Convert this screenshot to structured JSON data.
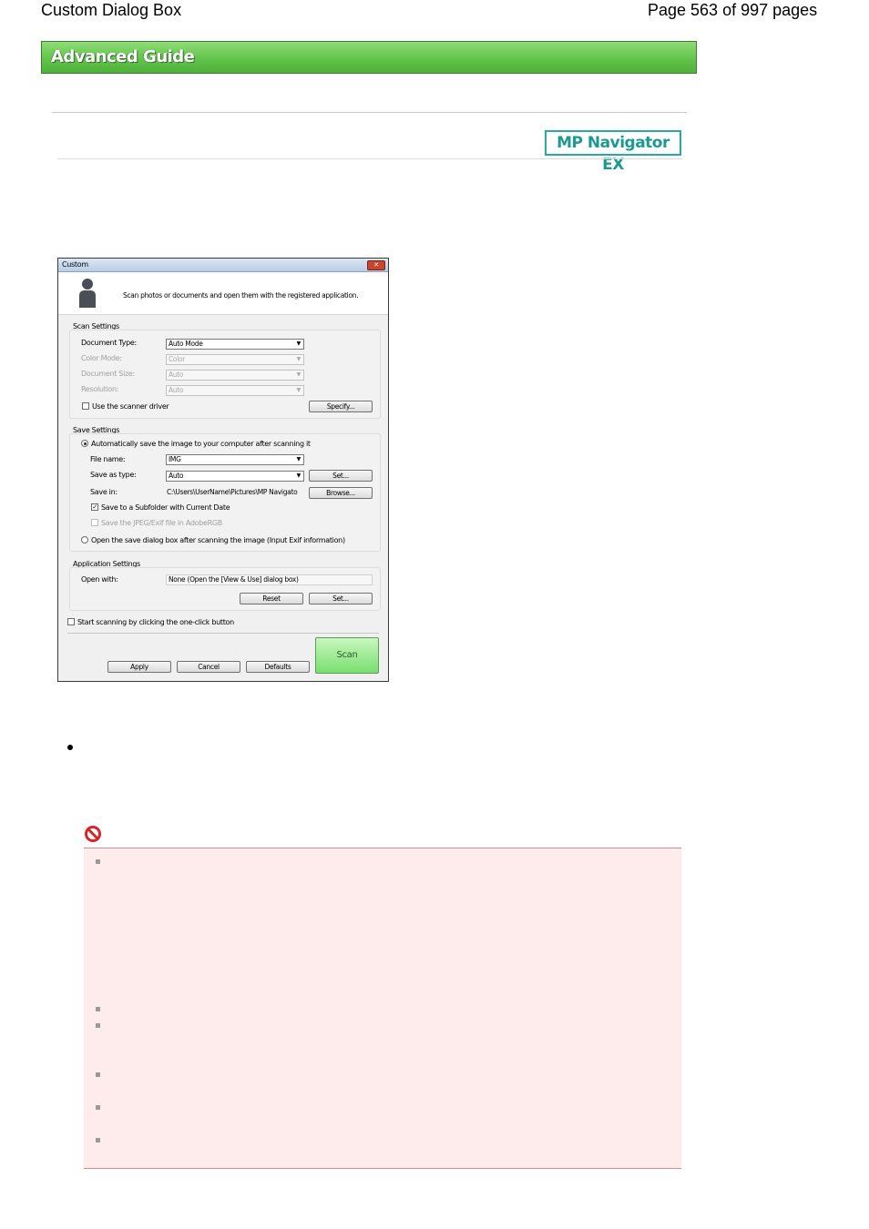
{
  "page_header": {
    "title": "Custom Dialog Box",
    "page_info": "Page 563 of 997 pages"
  },
  "guide_banner": "Advanced Guide",
  "logo": "MP Navigator EX",
  "dialog": {
    "title": "Custom",
    "close_glyph": "✕",
    "description": "Scan photos or documents and open them with the registered application.",
    "scan_settings": {
      "heading": "Scan Settings",
      "document_type_label": "Document Type:",
      "document_type_value": "Auto Mode",
      "color_mode_label": "Color Mode:",
      "color_mode_value": "Color",
      "document_size_label": "Document Size:",
      "document_size_value": "Auto",
      "resolution_label": "Resolution:",
      "resolution_value": "Auto",
      "use_driver_label": "Use the scanner driver",
      "specify_button": "Specify..."
    },
    "save_settings": {
      "heading": "Save Settings",
      "auto_save_label": "Automatically save the image to your computer after scanning it",
      "file_name_label": "File name:",
      "file_name_value": "IMG",
      "save_as_type_label": "Save as type:",
      "save_as_type_value": "Auto",
      "set_button": "Set...",
      "save_in_label": "Save in:",
      "save_in_value": "C:\\Users\\UserName\\Pictures\\MP Navigato",
      "browse_button": "Browse...",
      "subfolder_label": "Save to a Subfolder with Current Date",
      "adobergb_label": "Save the JPEG/Exif file in AdobeRGB",
      "open_save_dialog_label": "Open the save dialog box after scanning the image (Input Exif information)"
    },
    "application_settings": {
      "heading": "Application Settings",
      "open_with_label": "Open with:",
      "open_with_value": "None (Open the [View & Use] dialog box)",
      "reset_button": "Reset",
      "set_button": "Set..."
    },
    "one_click_label": "Start scanning by clicking the one-click button",
    "apply_button": "Apply",
    "cancel_button": "Cancel",
    "defaults_button": "Defaults",
    "scan_button": "Scan",
    "check_mark": "✓",
    "dropdown_arrow": "▼"
  },
  "colors": {
    "banner_green": "#62c44a",
    "logo_teal": "#1c9a92",
    "important_bg": "#fdeceb",
    "important_border": "#e08a8a"
  }
}
